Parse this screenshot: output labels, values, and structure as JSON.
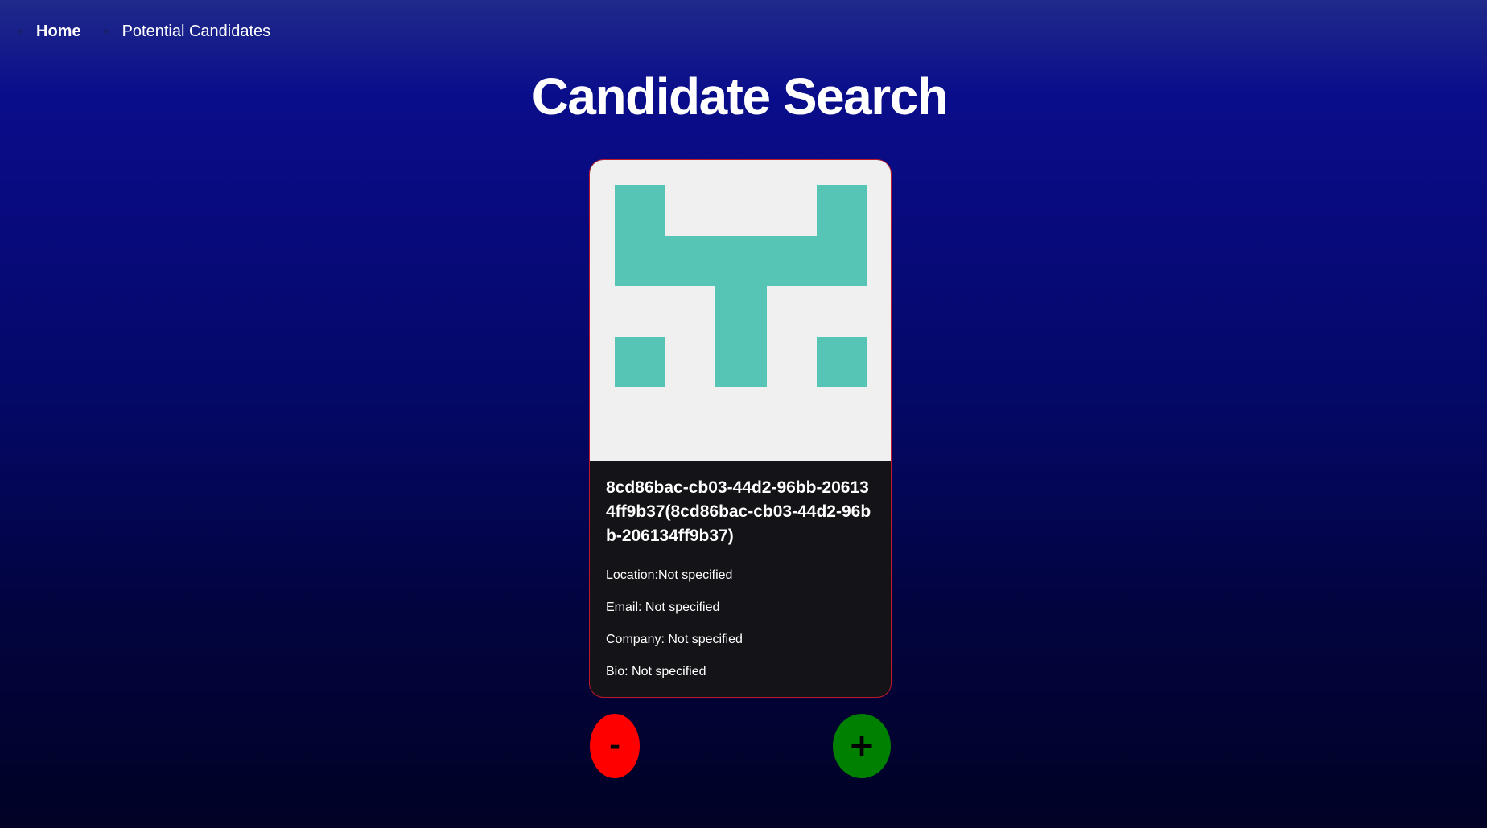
{
  "nav": {
    "home_label": "Home",
    "candidates_label": "Potential Candidates"
  },
  "page": {
    "title": "Candidate Search"
  },
  "candidate": {
    "avatar_icon": "identicon-avatar",
    "avatar_background": "#f0f0f0",
    "avatar_color": "#57c5b6",
    "name": "8cd86bac-cb03-44d2-96bb-206134ff9b37(8cd86bac-cb03-44d2-96bb-206134ff9b37)",
    "location": "Location:Not specified",
    "email": "Email: Not specified",
    "company": "Company: Not specified",
    "bio": "Bio: Not specified"
  },
  "actions": {
    "reject_label": "-",
    "accept_label": "+",
    "reject_color": "#ff0000",
    "accept_color": "#008000"
  }
}
